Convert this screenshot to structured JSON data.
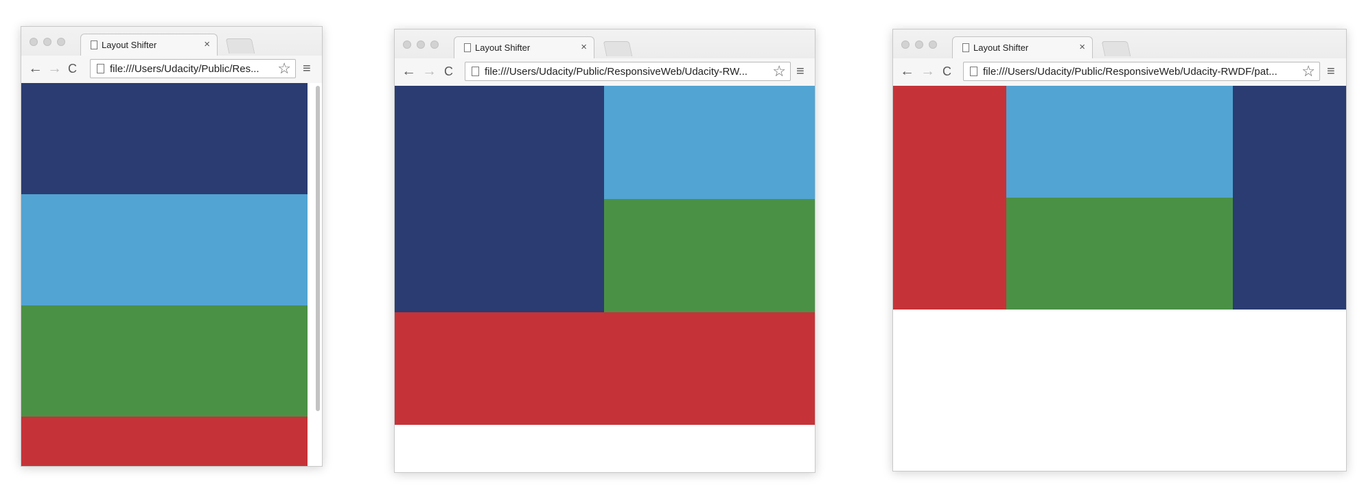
{
  "windows": [
    {
      "tab_title": "Layout Shifter",
      "tab_close": "×",
      "url": "file:///Users/Udacity/Public/Res...",
      "layout": "stacked"
    },
    {
      "tab_title": "Layout Shifter",
      "tab_close": "×",
      "url": "file:///Users/Udacity/Public/ResponsiveWeb/Udacity-RW...",
      "layout": "two-column-with-footer"
    },
    {
      "tab_title": "Layout Shifter",
      "tab_close": "×",
      "url": "file:///Users/Udacity/Public/ResponsiveWeb/Udacity-RWDF/pat...",
      "layout": "three-column"
    }
  ],
  "icons": {
    "back": "←",
    "forward": "→",
    "reload": "C",
    "star": "☆",
    "menu": "≡"
  },
  "colors": {
    "dark_blue": "#2a3c71",
    "light_blue": "#52a4d2",
    "green": "#4a9146",
    "red": "#c53338"
  }
}
